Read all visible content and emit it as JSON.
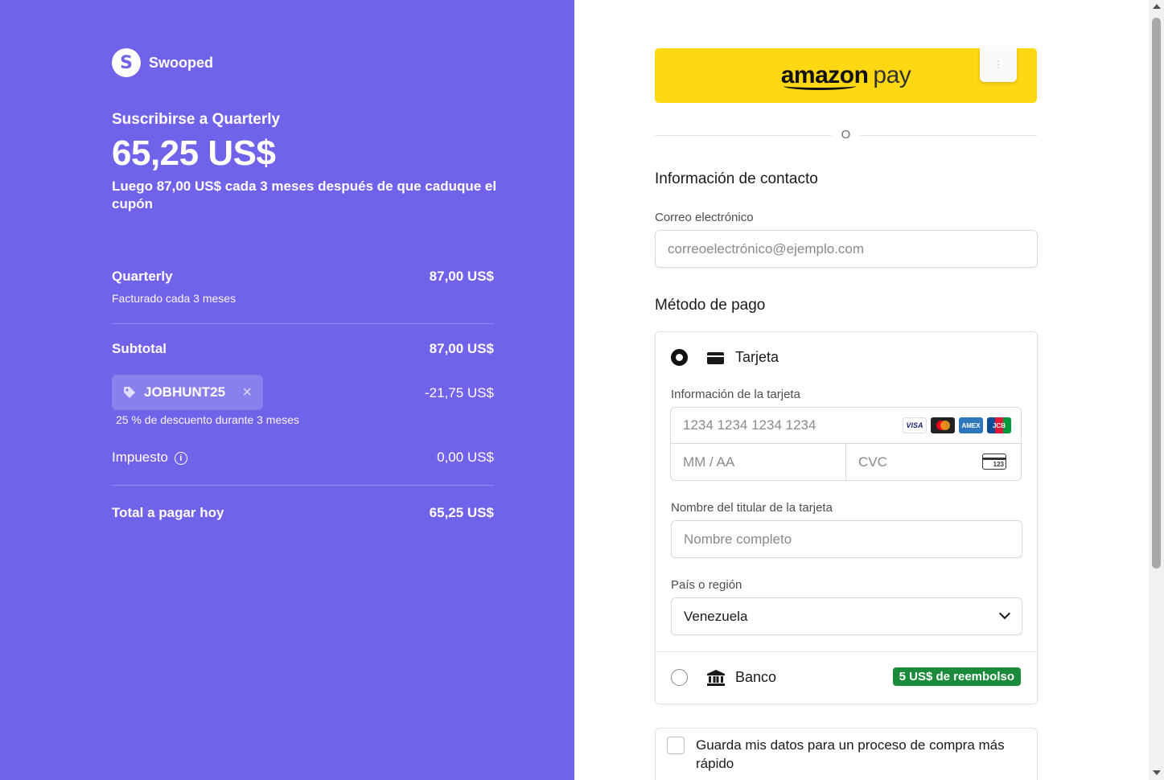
{
  "colors": {
    "panel": "#7063ea",
    "amazon_yellow": "#ffd814",
    "badge_green": "#1b8a3a"
  },
  "brand": {
    "logo_letter": "S",
    "name": "Swooped"
  },
  "summary": {
    "subscribe_title": "Suscribirse a Quarterly",
    "price": "65,25 US$",
    "after_note": "Luego 87,00 US$ cada 3 meses después de que caduque el cupón",
    "plan": {
      "name": "Quarterly",
      "billing": "Facturado cada 3 meses",
      "amount": "87,00 US$"
    },
    "subtotal": {
      "label": "Subtotal",
      "amount": "87,00 US$"
    },
    "coupon": {
      "code": "JOBHUNT25",
      "discount": "-21,75 US$",
      "note": "25 % de descuento durante 3 meses",
      "icon": "tag-icon",
      "remove_icon": "close-icon"
    },
    "tax": {
      "label": "Impuesto",
      "amount": "0,00 US$",
      "info_glyph": "i"
    },
    "total": {
      "label": "Total a pagar hoy",
      "amount": "65,25 US$"
    }
  },
  "checkout": {
    "amazon_pay": {
      "brand": "amazon",
      "word": "pay"
    },
    "or_text": "O",
    "contact": {
      "title": "Información de contacto",
      "email_label": "Correo electrónico",
      "email_placeholder": "correoelectrónico@ejemplo.com"
    },
    "payment": {
      "title": "Método de pago",
      "card_option": "Tarjeta",
      "card_info_label": "Información de la tarjeta",
      "card_number_placeholder": "1234 1234 1234 1234",
      "card_brands": [
        "VISA",
        "MC",
        "AMEX",
        "JCB"
      ],
      "expiry_placeholder": "MM / AA",
      "cvc_placeholder": "CVC",
      "cvc_icon_text": "123",
      "holder_label": "Nombre del titular de la tarjeta",
      "holder_placeholder": "Nombre completo",
      "country_label": "País o región",
      "country_value": "Venezuela",
      "bank_option": "Banco",
      "bank_badge": "5 US$ de reembolso"
    },
    "save_info": "Guarda mis datos para un proceso de compra más rápido"
  }
}
